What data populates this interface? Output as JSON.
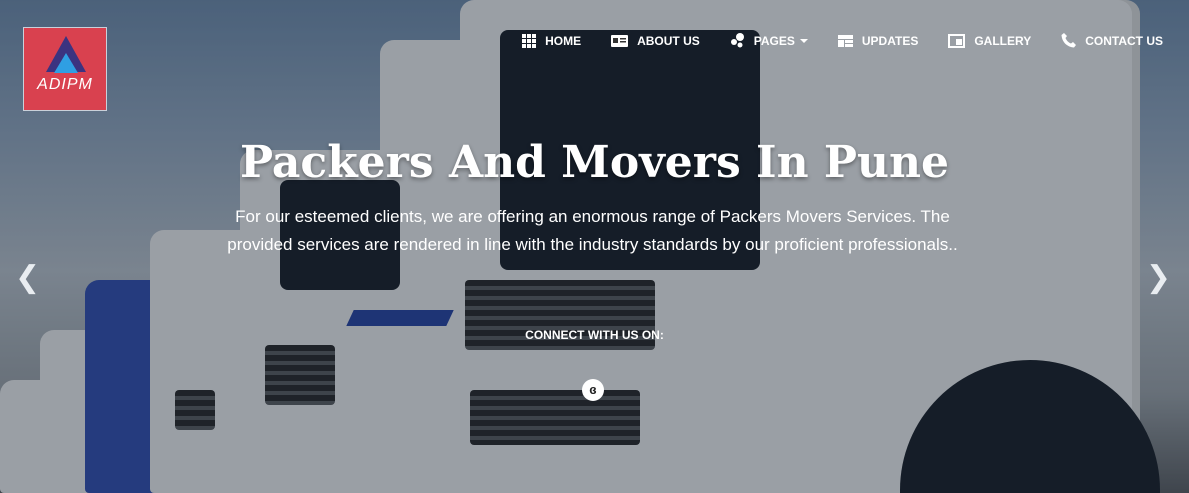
{
  "logo": {
    "text": "ADIPM"
  },
  "nav": [
    {
      "label": "HOME",
      "icon": "grid-icon"
    },
    {
      "label": "ABOUT US",
      "icon": "id-card-icon"
    },
    {
      "label": "PAGES",
      "icon": "bubbles-icon"
    },
    {
      "label": "UPDATES",
      "icon": "layout-icon"
    },
    {
      "label": "GALLERY",
      "icon": "window-icon"
    },
    {
      "label": "CONTACT US",
      "icon": "phone-icon"
    }
  ],
  "hero": {
    "title": "Packers And Movers In Pune",
    "subtitle": "For our esteemed clients, we are offering an enormous range of Packers Movers Services. The provided services are rendered in line with the industry standards by our proficient professionals..",
    "connect_label": "CONNECT WITH US ON:",
    "social_icon": "firefox-icon"
  },
  "carousel": {
    "prev_icon": "chevron-left-icon",
    "next_icon": "chevron-right-icon"
  }
}
